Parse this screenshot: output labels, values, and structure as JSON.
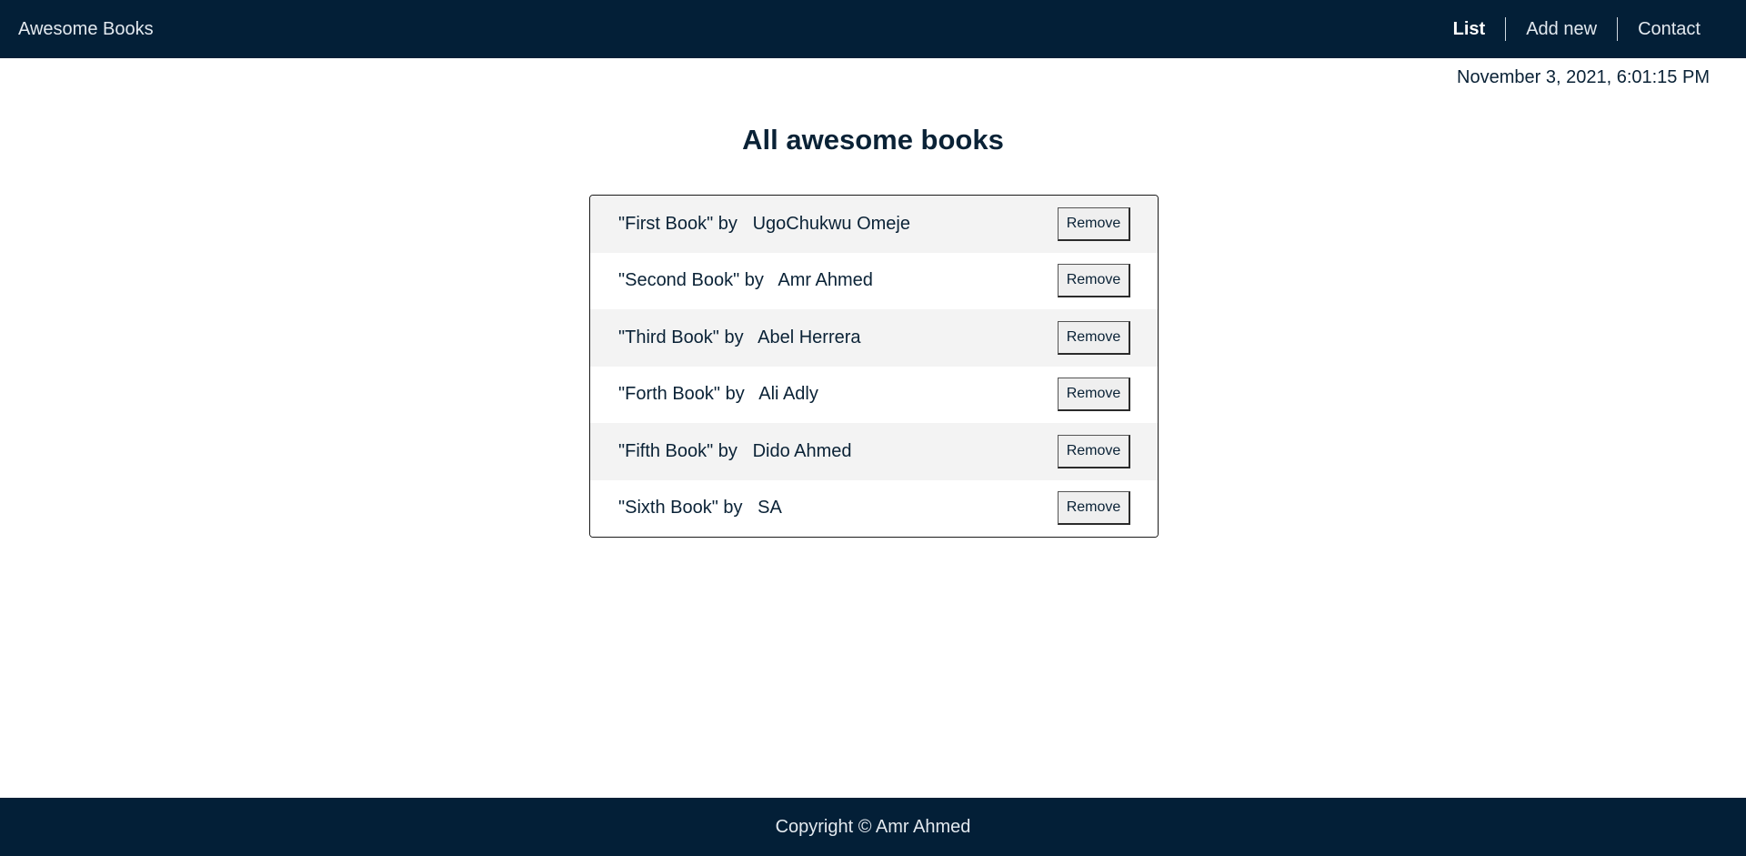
{
  "navbar": {
    "brand": "Awesome Books",
    "links": [
      {
        "label": "List",
        "active": true
      },
      {
        "label": "Add new",
        "active": false
      },
      {
        "label": "Contact",
        "active": false
      }
    ]
  },
  "timestamp": "November 3, 2021, 6:01:15 PM",
  "main": {
    "title": "All awesome books",
    "books": [
      {
        "title": "First Book",
        "author": "UgoChukwu Omeje",
        "text": "\"First Book\" by   UgoChukwu Omeje",
        "remove_label": "Remove"
      },
      {
        "title": "Second Book",
        "author": "Amr Ahmed",
        "text": "\"Second Book\" by   Amr Ahmed",
        "remove_label": "Remove"
      },
      {
        "title": "Third Book",
        "author": "Abel Herrera",
        "text": "\"Third Book\" by   Abel Herrera",
        "remove_label": "Remove"
      },
      {
        "title": "Forth Book",
        "author": "Ali Adly",
        "text": "\"Forth Book\" by   Ali Adly",
        "remove_label": "Remove"
      },
      {
        "title": "Fifth Book",
        "author": "Dido Ahmed",
        "text": "\"Fifth Book\" by   Dido Ahmed",
        "remove_label": "Remove"
      },
      {
        "title": "Sixth Book",
        "author": "SA",
        "text": "\"Sixth Book\" by   SA",
        "remove_label": "Remove"
      }
    ]
  },
  "footer": {
    "copyright": "Copyright © Amr Ahmed"
  },
  "colors": {
    "navbar_bg": "#031f37",
    "text": "#0a2236",
    "row_alt_bg": "#f3f3f3"
  }
}
